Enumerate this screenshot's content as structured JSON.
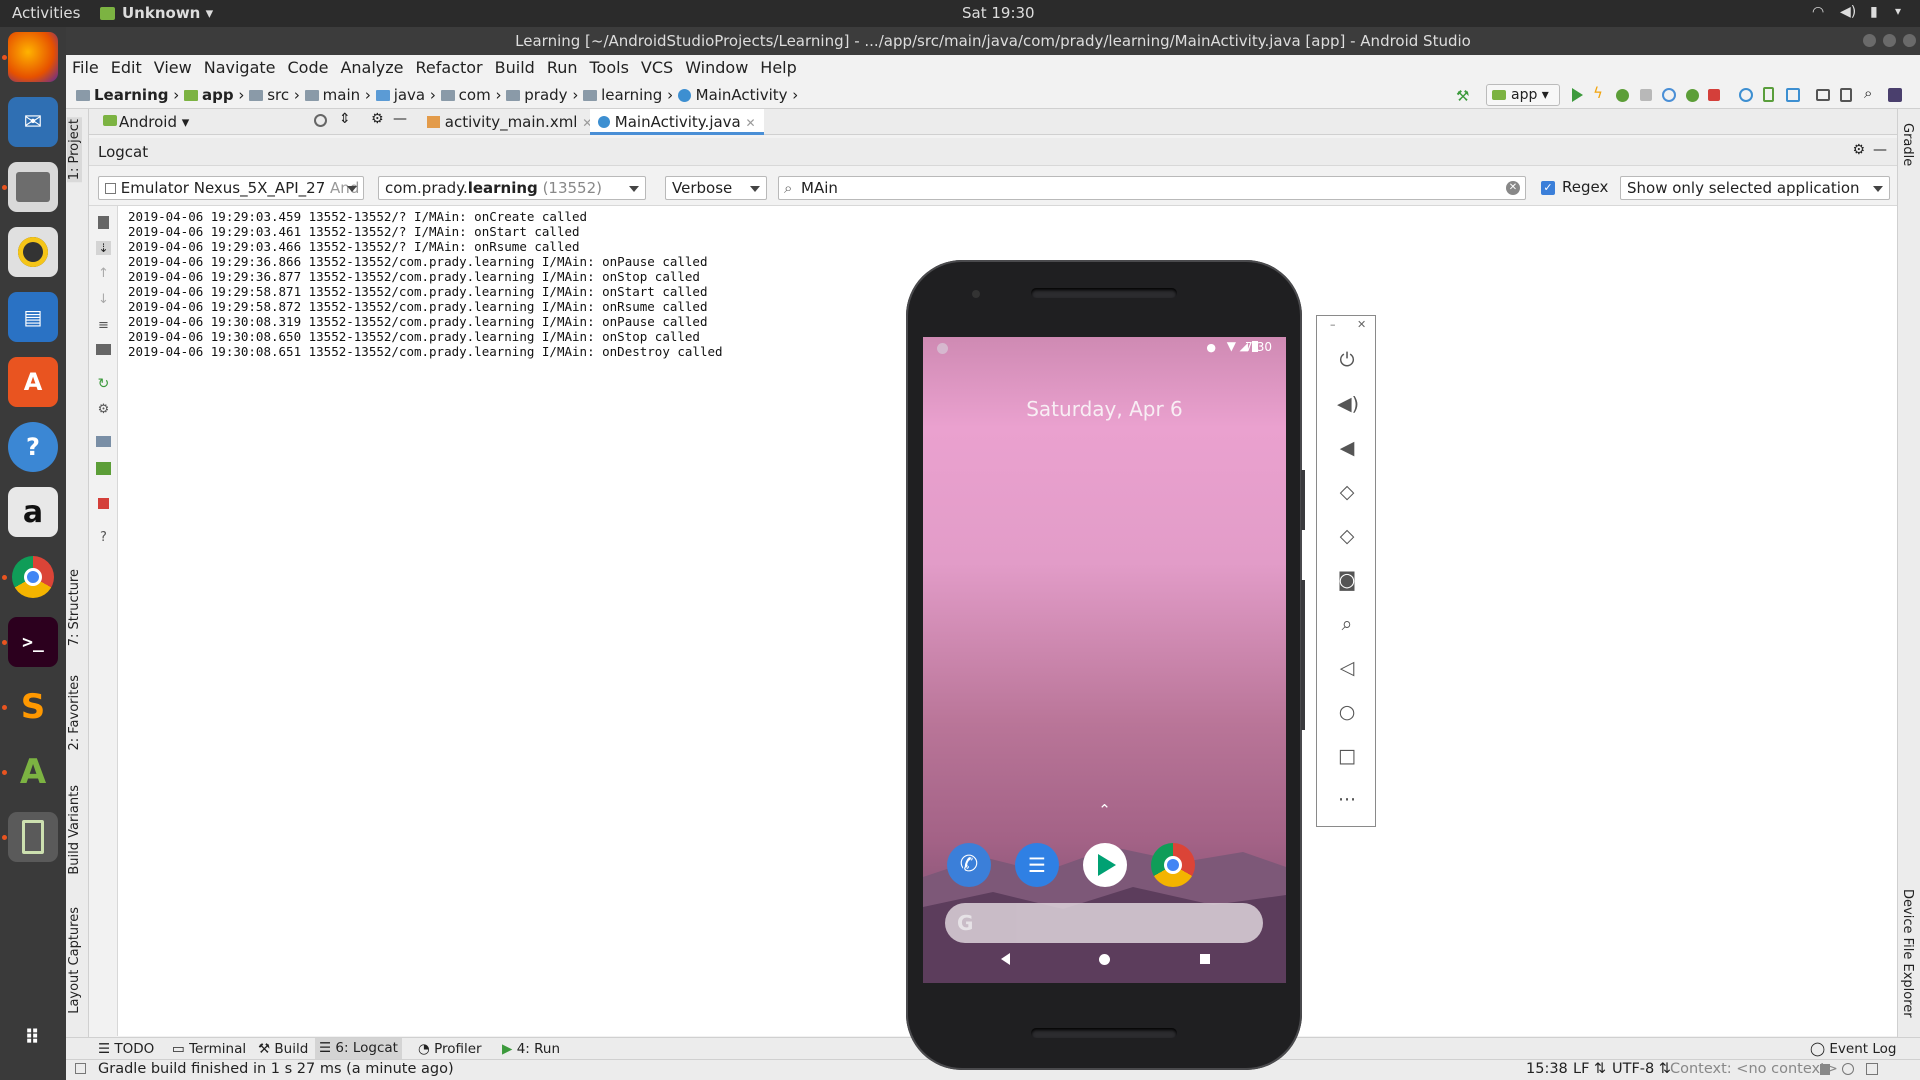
{
  "topbar": {
    "activities": "Activities",
    "app_name": "Unknown",
    "clock": "Sat 19:30"
  },
  "window": {
    "title": "Learning [~/AndroidStudioProjects/Learning] - .../app/src/main/java/com/prady/learning/MainActivity.java [app] - Android Studio"
  },
  "menu": [
    "File",
    "Edit",
    "View",
    "Navigate",
    "Code",
    "Analyze",
    "Refactor",
    "Build",
    "Run",
    "Tools",
    "VCS",
    "Window",
    "Help"
  ],
  "breadcrumb": [
    "Learning",
    "app",
    "src",
    "main",
    "java",
    "com",
    "prady",
    "learning",
    "MainActivity"
  ],
  "run_config": "app",
  "project_view": "Android",
  "tabs": [
    "activity_main.xml",
    "MainActivity.java"
  ],
  "left_tools": [
    "1: Project",
    "7: Structure",
    "2: Favorites",
    "Build Variants",
    "Layout Captures"
  ],
  "right_tools": [
    "Gradle",
    "Device File Explorer"
  ],
  "logcat": {
    "title": "Logcat",
    "device": "Emulator Nexus_5X_API_27",
    "device_suffix": "And",
    "process_prefix": "com.prady.",
    "process_bold": "learning",
    "process_pid": "(13552)",
    "level": "Verbose",
    "search": "MAin",
    "regex_label": "Regex",
    "regex_checked": true,
    "filter": "Show only selected application",
    "lines": [
      "2019-04-06 19:29:03.459 13552-13552/? I/MAin: onCreate called",
      "2019-04-06 19:29:03.461 13552-13552/? I/MAin: onStart called",
      "2019-04-06 19:29:03.466 13552-13552/? I/MAin: onRsume called",
      "2019-04-06 19:29:36.866 13552-13552/com.prady.learning I/MAin: onPause called",
      "2019-04-06 19:29:36.877 13552-13552/com.prady.learning I/MAin: onStop called",
      "2019-04-06 19:29:58.871 13552-13552/com.prady.learning I/MAin: onStart called",
      "2019-04-06 19:29:58.872 13552-13552/com.prady.learning I/MAin: onRsume called",
      "2019-04-06 19:30:08.319 13552-13552/com.prady.learning I/MAin: onPause called",
      "2019-04-06 19:30:08.650 13552-13552/com.prady.learning I/MAin: onStop called",
      "2019-04-06 19:30:08.651 13552-13552/com.prady.learning I/MAin: onDestroy called"
    ]
  },
  "bottom_tools": [
    {
      "label": "TODO"
    },
    {
      "label": "Terminal"
    },
    {
      "label": "Build"
    },
    {
      "label": "6: Logcat"
    },
    {
      "label": "Profiler"
    },
    {
      "label": "4: Run"
    }
  ],
  "event_log": "Event Log",
  "status": {
    "message": "Gradle build finished in 1 s 27 ms (a minute ago)",
    "position": "15:38",
    "line_sep": "LF",
    "encoding": "UTF-8",
    "context": "Context: <no context>"
  },
  "phone": {
    "status_time": "7:30",
    "date": "Saturday, Apr 6"
  },
  "colors": {
    "accent": "#e95420",
    "android_green": "#7cb342",
    "stop_red": "#d43f3a"
  }
}
